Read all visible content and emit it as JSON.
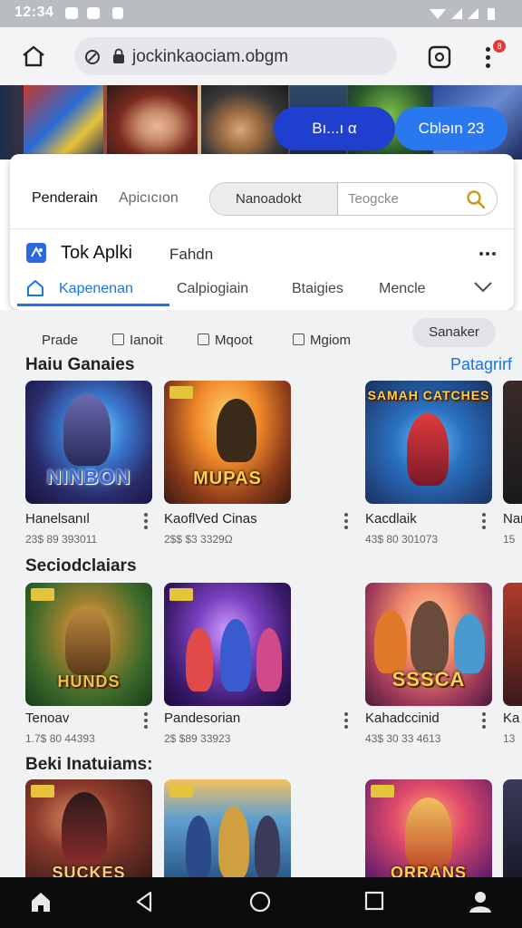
{
  "status_bar": {
    "time": "12:34"
  },
  "browser": {
    "url": "jockinkaociam.obgm",
    "notification_count": "8"
  },
  "hero": {
    "button_left": "Bı...ı α",
    "button_right": "Cbləın 23"
  },
  "card": {
    "tabs": [
      "Penderain",
      "Apicıcıon"
    ],
    "search_left": "Nanoadokt",
    "search_placeholder": "Teogcke",
    "app_title": "Tok Aplki",
    "app_subtitle": "Fahdn",
    "nav": [
      "Kapenenan",
      "Calpiogiain",
      "Btaigies",
      "Mencle"
    ]
  },
  "chips": [
    "Prade",
    "Ianoit",
    "Mqoot",
    "Mgiom"
  ],
  "chip_button": "Sanaker",
  "sections": [
    {
      "title": "Haiu Ganaies",
      "link": "Patagrirf",
      "items": [
        {
          "thumb_text": "NINBON",
          "name": "Hanelsanıl",
          "meta": "23$ 89 393011"
        },
        {
          "thumb_text": "MUPAS",
          "name": "KaoflVed Cinas",
          "meta": "2$$ $3 3329Ω"
        },
        {
          "thumb_text": "SAMAH CATCHES",
          "name": "Kacdlaik",
          "meta": "43$ 80 301073"
        },
        {
          "thumb_text": "",
          "name": "Nar",
          "meta": "15"
        }
      ]
    },
    {
      "title": "Seciodclaiars",
      "link": "",
      "items": [
        {
          "thumb_text": "HUNDS",
          "name": "Tenoav",
          "meta": "1.7$ 80 44393"
        },
        {
          "thumb_text": "",
          "name": "Pandesorian",
          "meta": "2$ $89 33923"
        },
        {
          "thumb_text": "SSSCA",
          "name": "Kahadccinid",
          "meta": "43$ 30 33 4613"
        },
        {
          "thumb_text": "",
          "name": "Ka",
          "meta": "13"
        }
      ]
    },
    {
      "title": "Beki Inatuiams:",
      "link": "",
      "items": [
        {
          "thumb_text": "SUCKES",
          "name": "",
          "meta": ""
        },
        {
          "thumb_text": "",
          "name": "",
          "meta": ""
        },
        {
          "thumb_text": "ORRANS",
          "name": "",
          "meta": ""
        }
      ]
    }
  ],
  "colors": {
    "accent_blue": "#1a73e8",
    "hero_button": "#1f4ccf",
    "nav_underline": "#1a73e8"
  },
  "icons": [
    "home-icon",
    "tab-switcher-icon",
    "kebab-menu-icon",
    "search-icon",
    "apps-icon",
    "chevron-down-icon",
    "back-icon",
    "circle-home-icon",
    "recents-icon",
    "profile-icon"
  ]
}
